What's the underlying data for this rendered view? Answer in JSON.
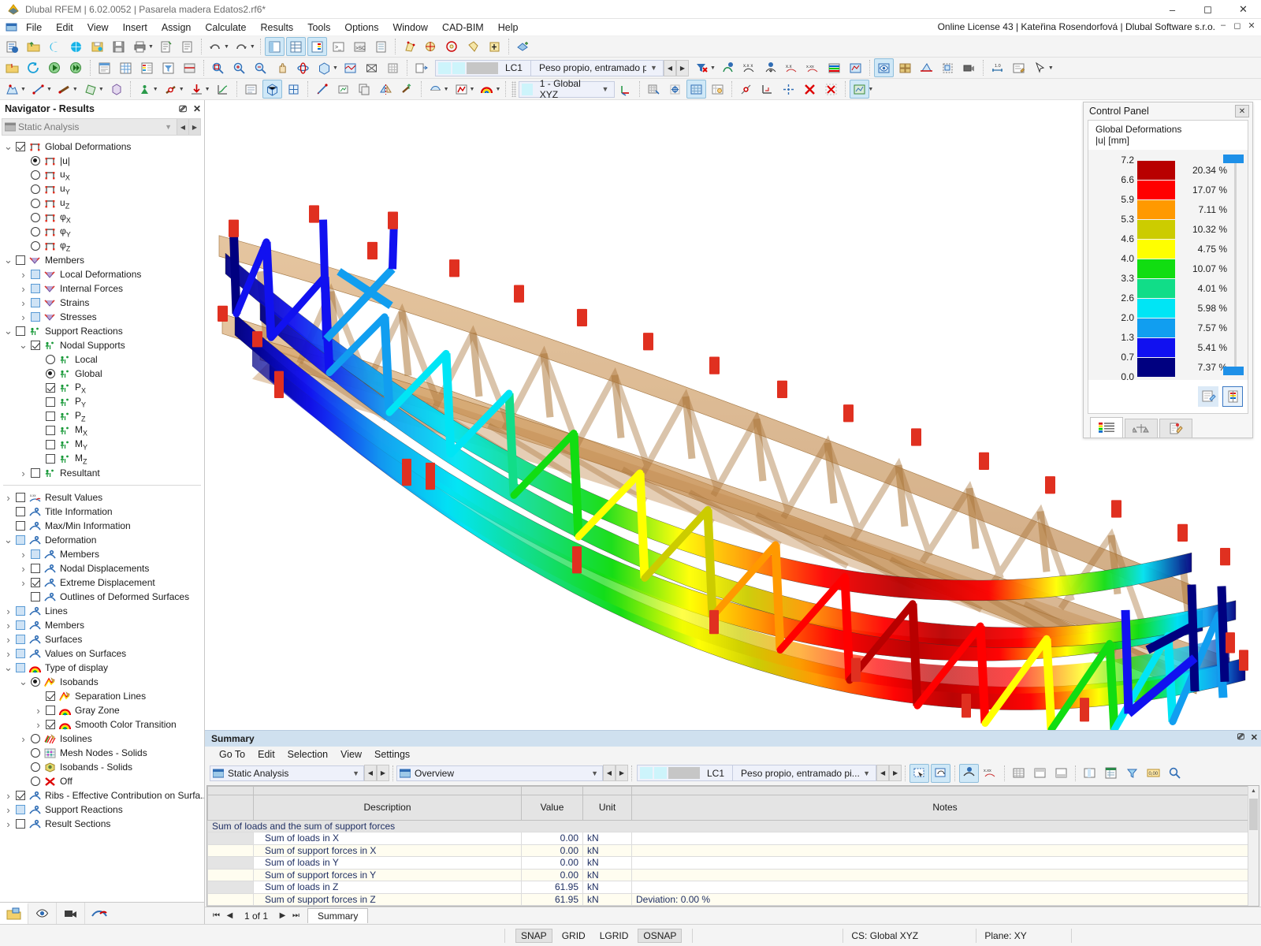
{
  "window": {
    "title": "Dlubal RFEM | 6.02.0052 | Pasarela madera Edatos2.rf6*",
    "license": "Online License 43 | Kateřina Rosendorfová | Dlubal Software s.r.o.",
    "minimize": "–",
    "maximize": "☐",
    "close": "✕"
  },
  "menu": {
    "items": [
      "File",
      "Edit",
      "View",
      "Insert",
      "Assign",
      "Calculate",
      "Results",
      "Tools",
      "Options",
      "Window",
      "CAD-BIM",
      "Help"
    ]
  },
  "toolbar": {
    "load_case_id": "LC1",
    "load_case_name": "Peso propio, entramado pi...",
    "coord_system": "1 - Global XYZ"
  },
  "navigator": {
    "title": "Navigator - Results",
    "analysis": "Static Analysis",
    "tree": [
      {
        "label": "Global Deformations",
        "indent": 0,
        "twist": "v",
        "ctrl": "checkbox-checked",
        "icon": "surface-icon"
      },
      {
        "label": "|u|",
        "indent": 1,
        "twist": "",
        "ctrl": "radio-selected",
        "icon": "surface-icon"
      },
      {
        "label": "u",
        "sub": "X",
        "indent": 1,
        "twist": "",
        "ctrl": "radio",
        "icon": "surface-icon"
      },
      {
        "label": "u",
        "sub": "Y",
        "indent": 1,
        "twist": "",
        "ctrl": "radio",
        "icon": "surface-icon"
      },
      {
        "label": "u",
        "sub": "Z",
        "indent": 1,
        "twist": "",
        "ctrl": "radio",
        "icon": "surface-icon"
      },
      {
        "label": "φ",
        "sub": "X",
        "indent": 1,
        "twist": "",
        "ctrl": "radio",
        "icon": "surface-icon"
      },
      {
        "label": "φ",
        "sub": "Y",
        "indent": 1,
        "twist": "",
        "ctrl": "radio",
        "icon": "surface-icon"
      },
      {
        "label": "φ",
        "sub": "Z",
        "indent": 1,
        "twist": "",
        "ctrl": "radio",
        "icon": "surface-icon"
      },
      {
        "label": "Members",
        "indent": 0,
        "twist": "v",
        "ctrl": "checkbox",
        "icon": "member-icon"
      },
      {
        "label": "Local Deformations",
        "indent": 1,
        "twist": ">",
        "ctrl": "checkbox-blue",
        "icon": "member-icon"
      },
      {
        "label": "Internal Forces",
        "indent": 1,
        "twist": ">",
        "ctrl": "checkbox-blue",
        "icon": "member-icon"
      },
      {
        "label": "Strains",
        "indent": 1,
        "twist": ">",
        "ctrl": "checkbox-blue",
        "icon": "member-icon"
      },
      {
        "label": "Stresses",
        "indent": 1,
        "twist": ">",
        "ctrl": "checkbox-blue",
        "icon": "member-icon"
      },
      {
        "label": "Support Reactions",
        "indent": 0,
        "twist": "v",
        "ctrl": "checkbox",
        "icon": "support-icon"
      },
      {
        "label": "Nodal Supports",
        "indent": 1,
        "twist": "v",
        "ctrl": "checkbox-checked",
        "icon": "support-icon"
      },
      {
        "label": "Local",
        "indent": 2,
        "twist": "",
        "ctrl": "radio",
        "icon": "support-icon"
      },
      {
        "label": "Global",
        "indent": 2,
        "twist": "",
        "ctrl": "radio-selected",
        "icon": "support-icon"
      },
      {
        "label": "P",
        "sub": "X",
        "indent": 2,
        "twist": "",
        "ctrl": "checkbox-checked",
        "icon": "support-icon"
      },
      {
        "label": "P",
        "sub": "Y",
        "indent": 2,
        "twist": "",
        "ctrl": "checkbox",
        "icon": "support-icon"
      },
      {
        "label": "P",
        "sub": "Z",
        "indent": 2,
        "twist": "",
        "ctrl": "checkbox",
        "icon": "support-icon"
      },
      {
        "label": "M",
        "sub": "X",
        "indent": 2,
        "twist": "",
        "ctrl": "checkbox",
        "icon": "support-icon"
      },
      {
        "label": "M",
        "sub": "Y",
        "indent": 2,
        "twist": "",
        "ctrl": "checkbox",
        "icon": "support-icon"
      },
      {
        "label": "M",
        "sub": "Z",
        "indent": 2,
        "twist": "",
        "ctrl": "checkbox",
        "icon": "support-icon"
      },
      {
        "label": "Resultant",
        "indent": 1,
        "twist": ">",
        "ctrl": "checkbox",
        "icon": "support-icon"
      }
    ],
    "tree2": [
      {
        "label": "Result Values",
        "indent": 0,
        "twist": ">",
        "ctrl": "checkbox",
        "icon": "values-icon"
      },
      {
        "label": "Title Information",
        "indent": 0,
        "twist": "",
        "ctrl": "checkbox",
        "icon": "display-icon"
      },
      {
        "label": "Max/Min Information",
        "indent": 0,
        "twist": "",
        "ctrl": "checkbox",
        "icon": "display-icon"
      },
      {
        "label": "Deformation",
        "indent": 0,
        "twist": "v",
        "ctrl": "checkbox-blue",
        "icon": "display-icon"
      },
      {
        "label": "Members",
        "indent": 1,
        "twist": ">",
        "ctrl": "checkbox-blue",
        "icon": "display-icon"
      },
      {
        "label": "Nodal Displacements",
        "indent": 1,
        "twist": ">",
        "ctrl": "checkbox",
        "icon": "display-icon"
      },
      {
        "label": "Extreme Displacement",
        "indent": 1,
        "twist": ">",
        "ctrl": "checkbox-checked",
        "icon": "display-icon"
      },
      {
        "label": "Outlines of Deformed Surfaces",
        "indent": 1,
        "twist": "",
        "ctrl": "checkbox",
        "icon": "display-icon"
      },
      {
        "label": "Lines",
        "indent": 0,
        "twist": ">",
        "ctrl": "checkbox-blue",
        "icon": "display-icon"
      },
      {
        "label": "Members",
        "indent": 0,
        "twist": ">",
        "ctrl": "checkbox-blue",
        "icon": "display-icon"
      },
      {
        "label": "Surfaces",
        "indent": 0,
        "twist": ">",
        "ctrl": "checkbox-blue",
        "icon": "display-icon"
      },
      {
        "label": "Values on Surfaces",
        "indent": 0,
        "twist": ">",
        "ctrl": "checkbox-blue",
        "icon": "display-icon"
      },
      {
        "label": "Type of display",
        "indent": 0,
        "twist": "v",
        "ctrl": "checkbox-blue",
        "icon": "rainbow-icon"
      },
      {
        "label": "Isobands",
        "indent": 1,
        "twist": "v",
        "ctrl": "radio-selected",
        "icon": "isoband-icon"
      },
      {
        "label": "Separation Lines",
        "indent": 2,
        "twist": "",
        "ctrl": "checkbox-checked",
        "icon": "isoband-icon"
      },
      {
        "label": "Gray Zone",
        "indent": 2,
        "twist": ">",
        "ctrl": "checkbox",
        "icon": "rainbow-icon"
      },
      {
        "label": "Smooth Color Transition",
        "indent": 2,
        "twist": ">",
        "ctrl": "checkbox-checked",
        "icon": "rainbow-icon"
      },
      {
        "label": "Isolines",
        "indent": 1,
        "twist": ">",
        "ctrl": "radio",
        "icon": "isoline-icon"
      },
      {
        "label": "Mesh Nodes - Solids",
        "indent": 1,
        "twist": "",
        "ctrl": "radio",
        "icon": "mesh-icon"
      },
      {
        "label": "Isobands - Solids",
        "indent": 1,
        "twist": "",
        "ctrl": "radio",
        "icon": "solid-icon"
      },
      {
        "label": "Off",
        "indent": 1,
        "twist": "",
        "ctrl": "radio",
        "icon": "off-icon"
      },
      {
        "label": "Ribs - Effective Contribution on Surfa...",
        "indent": 0,
        "twist": ">",
        "ctrl": "checkbox-checked",
        "icon": "display-icon"
      },
      {
        "label": "Support Reactions",
        "indent": 0,
        "twist": ">",
        "ctrl": "checkbox-blue",
        "icon": "display-icon"
      },
      {
        "label": "Result Sections",
        "indent": 0,
        "twist": ">",
        "ctrl": "checkbox",
        "icon": "display-icon"
      }
    ],
    "bottom_tabs": [
      "project-icon",
      "view-icon",
      "camera-icon",
      "results-icon"
    ]
  },
  "control_panel": {
    "title": "Control Panel",
    "close": "✕",
    "legend_title": "Global Deformations",
    "legend_unit": "|u| [mm]",
    "scale_ticks": [
      "7.2",
      "6.6",
      "5.9",
      "5.3",
      "4.6",
      "4.0",
      "3.3",
      "2.6",
      "2.0",
      "1.3",
      "0.7",
      "0.0"
    ],
    "bands": [
      {
        "color": "#b80000",
        "percent": "20.34 %"
      },
      {
        "color": "#ff0000",
        "percent": "17.07 %"
      },
      {
        "color": "#ff9900",
        "percent": "7.11 %"
      },
      {
        "color": "#cccc00",
        "percent": "10.32 %"
      },
      {
        "color": "#ffff00",
        "percent": "4.75 %"
      },
      {
        "color": "#11dd11",
        "percent": "10.07 %"
      },
      {
        "color": "#11dd88",
        "percent": "4.01 %"
      },
      {
        "color": "#00e5f5",
        "percent": "5.98 %"
      },
      {
        "color": "#119ef0",
        "percent": "7.57 %"
      },
      {
        "color": "#1111f0",
        "percent": "5.41 %"
      },
      {
        "color": "#000080",
        "percent": "7.37 %"
      }
    ],
    "tabs": [
      "color-legend-tab",
      "scale-factor-tab",
      "display-properties-tab"
    ],
    "footer_buttons": [
      "edit-legend-button",
      "legend-settings-button"
    ]
  },
  "summary": {
    "title": "Summary",
    "menu": [
      "Go To",
      "Edit",
      "Selection",
      "View",
      "Settings"
    ],
    "analysis": "Static Analysis",
    "view": "Overview",
    "load_case_id": "LC1",
    "load_case_name": "Peso propio, entramado pi...",
    "columns": [
      "",
      "Description",
      "Value",
      "Unit",
      "Notes"
    ],
    "group_row": "Sum of loads and the sum of support forces",
    "rows": [
      {
        "description": "Sum of loads in X",
        "value": "0.00",
        "unit": "kN",
        "notes": ""
      },
      {
        "description": "Sum of support forces in X",
        "value": "0.00",
        "unit": "kN",
        "notes": ""
      },
      {
        "description": "Sum of loads in Y",
        "value": "0.00",
        "unit": "kN",
        "notes": ""
      },
      {
        "description": "Sum of support forces in Y",
        "value": "0.00",
        "unit": "kN",
        "notes": ""
      },
      {
        "description": "Sum of loads in Z",
        "value": "61.95",
        "unit": "kN",
        "notes": ""
      },
      {
        "description": "Sum of support forces in Z",
        "value": "61.95",
        "unit": "kN",
        "notes": "Deviation: 0.00 %"
      }
    ],
    "page": "1 of 1",
    "tab": "Summary"
  },
  "statusbar": {
    "snap": "SNAP",
    "grid": "GRID",
    "lgrid": "LGRID",
    "osnap": "OSNAP",
    "cs": "CS: Global XYZ",
    "plane": "Plane: XY"
  }
}
